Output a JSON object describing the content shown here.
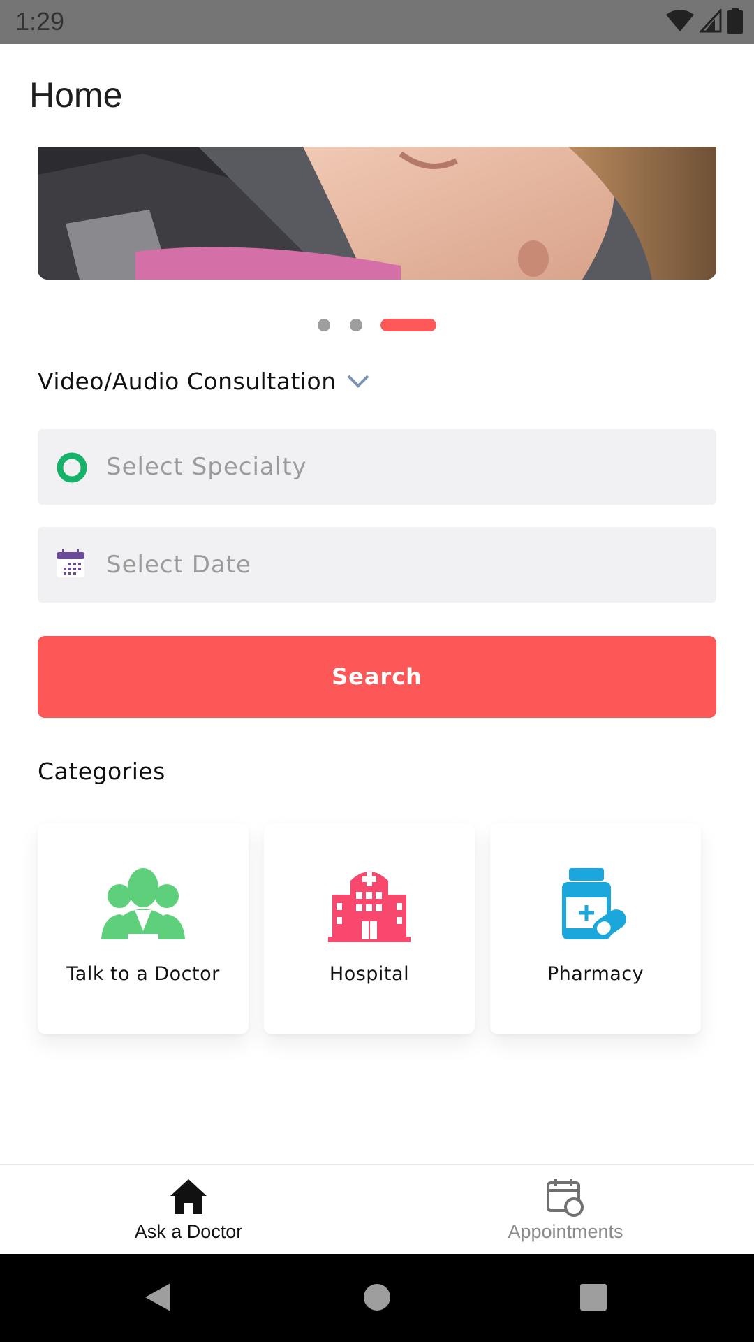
{
  "status_bar": {
    "time": "1:29"
  },
  "app_bar": {
    "title": "Home"
  },
  "carousel": {
    "page_count": 3,
    "active_index": 2
  },
  "consultation": {
    "label": "Video/Audio Consultation"
  },
  "specialty_field": {
    "placeholder": "Select Specialty"
  },
  "date_field": {
    "placeholder": "Select Date"
  },
  "search_button": {
    "label": "Search"
  },
  "categories": {
    "title": "Categories",
    "items": [
      {
        "label": "Talk to a Doctor",
        "icon": "doctor-group-icon",
        "color": "#5ecf7a"
      },
      {
        "label": "Hospital",
        "icon": "hospital-icon",
        "color": "#f8486e"
      },
      {
        "label": "Pharmacy",
        "icon": "pharmacy-icon",
        "color": "#1ca7dc"
      }
    ]
  },
  "bottom_nav": {
    "items": [
      {
        "label": "Ask a Doctor",
        "icon": "home-icon",
        "active": true
      },
      {
        "label": "Appointments",
        "icon": "calendar-clock-icon",
        "active": false
      }
    ]
  },
  "colors": {
    "accent": "#fd5757",
    "field_bg": "#f1f1f4",
    "radio_green": "#17b26a"
  }
}
